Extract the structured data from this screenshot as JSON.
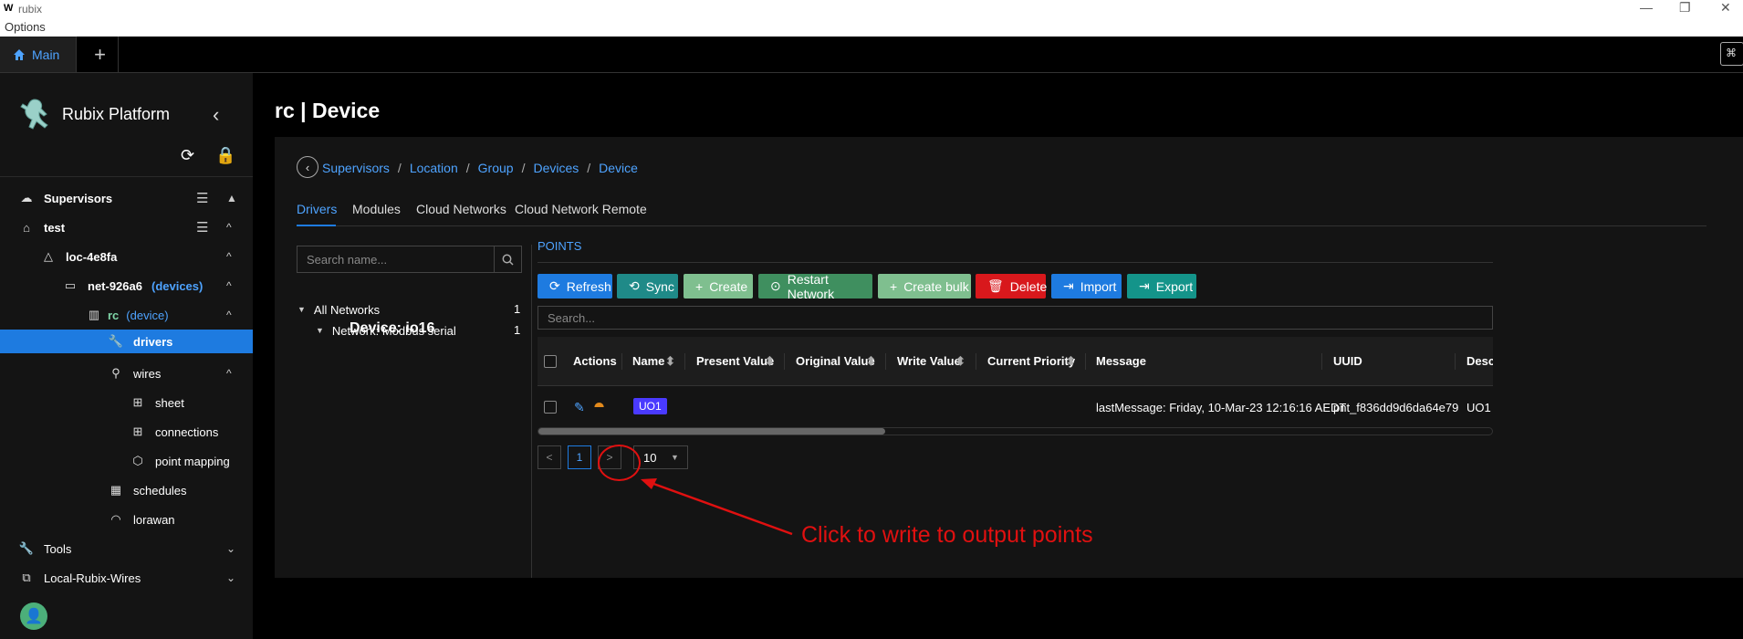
{
  "window": {
    "logo": "W",
    "title": "rubix",
    "menu": "Options"
  },
  "tabbar": {
    "main_tab": "Main",
    "plus": "+",
    "corner": "⌘"
  },
  "sidebar": {
    "brand": "Rubix Platform",
    "tree": [
      {
        "label": "Supervisors",
        "icon": "cloud-icon"
      },
      {
        "label": "test",
        "icon": "home-icon"
      },
      {
        "label": "loc-4e8fa",
        "icon": "warning-triangle-icon"
      },
      {
        "label": "net-926a6",
        "suffix": "(devices)",
        "icon": "laptop-icon"
      },
      {
        "label": "rc",
        "suffix": "(device)",
        "icon": "device-icon"
      },
      {
        "label": "drivers",
        "icon": "wrench-icon"
      },
      {
        "label": "wires",
        "icon": "wires-icon"
      },
      {
        "label": "sheet",
        "icon": "sheet-icon"
      },
      {
        "label": "connections",
        "icon": "connections-icon"
      },
      {
        "label": "point mapping",
        "icon": "point-mapping-icon"
      },
      {
        "label": "schedules",
        "icon": "calendar-icon"
      },
      {
        "label": "lorawan",
        "icon": "wifi-icon"
      },
      {
        "label": "Tools",
        "icon": "tools-icon"
      },
      {
        "label": "Local-Rubix-Wires",
        "icon": "network-icon"
      }
    ]
  },
  "page": {
    "title": "rc | Device",
    "breadcrumb": [
      "Supervisors",
      "Location",
      "Group",
      "Devices",
      "Device"
    ],
    "tabs": [
      "Drivers",
      "Modules",
      "Cloud Networks",
      "Cloud Network Remote"
    ],
    "search_name_placeholder": "Search name...",
    "networks": {
      "all_label": "All Networks",
      "all_count": "1",
      "network_label": "Network: Modbus serial",
      "network_count": "1",
      "device_label": "Device: io16"
    },
    "points_tab": "POINTS",
    "buttons": [
      "Refresh",
      "Sync",
      "Create",
      "Restart Network",
      "Create bulk",
      "Delete",
      "Import",
      "Export"
    ],
    "search_placeholder": "Search...",
    "columns": [
      "Actions",
      "Name",
      "Present Value",
      "Original Value",
      "Write Value",
      "Current Priority",
      "Message",
      "UUID",
      "Descr"
    ],
    "rows": [
      {
        "name": "UO1",
        "message": "lastMessage: Friday, 10-Mar-23 12:16:16 AEDT",
        "uuid": "pnt_f836dd9d6da64e79",
        "description": "UO1"
      }
    ],
    "pagination": {
      "prev": "<",
      "page": "1",
      "next": ">",
      "page_size": "10"
    }
  },
  "annotation": {
    "text": "Click to write to output points"
  },
  "colors": {
    "accent": "#1e7be0",
    "delete": "#d8181c",
    "annotation": "#e01010",
    "name_tag": "#4a3aff"
  }
}
